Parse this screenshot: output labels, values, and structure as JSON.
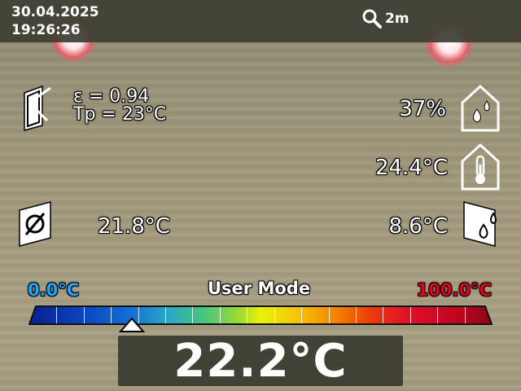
{
  "status": {
    "date": "30.04.2025",
    "time": "19:26:26",
    "distance": "2m"
  },
  "emissivity": {
    "line1": "ε  = 0.94",
    "line2": "Tp = 23°C"
  },
  "humidity": {
    "value": "37%"
  },
  "ambient_temp": {
    "value": "24.4°C"
  },
  "surface_temp": {
    "value": "21.8°C"
  },
  "dew_point": {
    "value": "8.6°C"
  },
  "scale": {
    "min": "0.0°C",
    "max": "100.0°C",
    "mode": "User Mode",
    "marker_fraction": 0.222
  },
  "main_reading": {
    "value": "22.2°C"
  },
  "icons": [
    "magnifier-icon",
    "emissivity-icon",
    "humidity-icon",
    "thermometer-icon",
    "surface-temp-icon",
    "dew-point-icon",
    "scale-marker-icon"
  ]
}
